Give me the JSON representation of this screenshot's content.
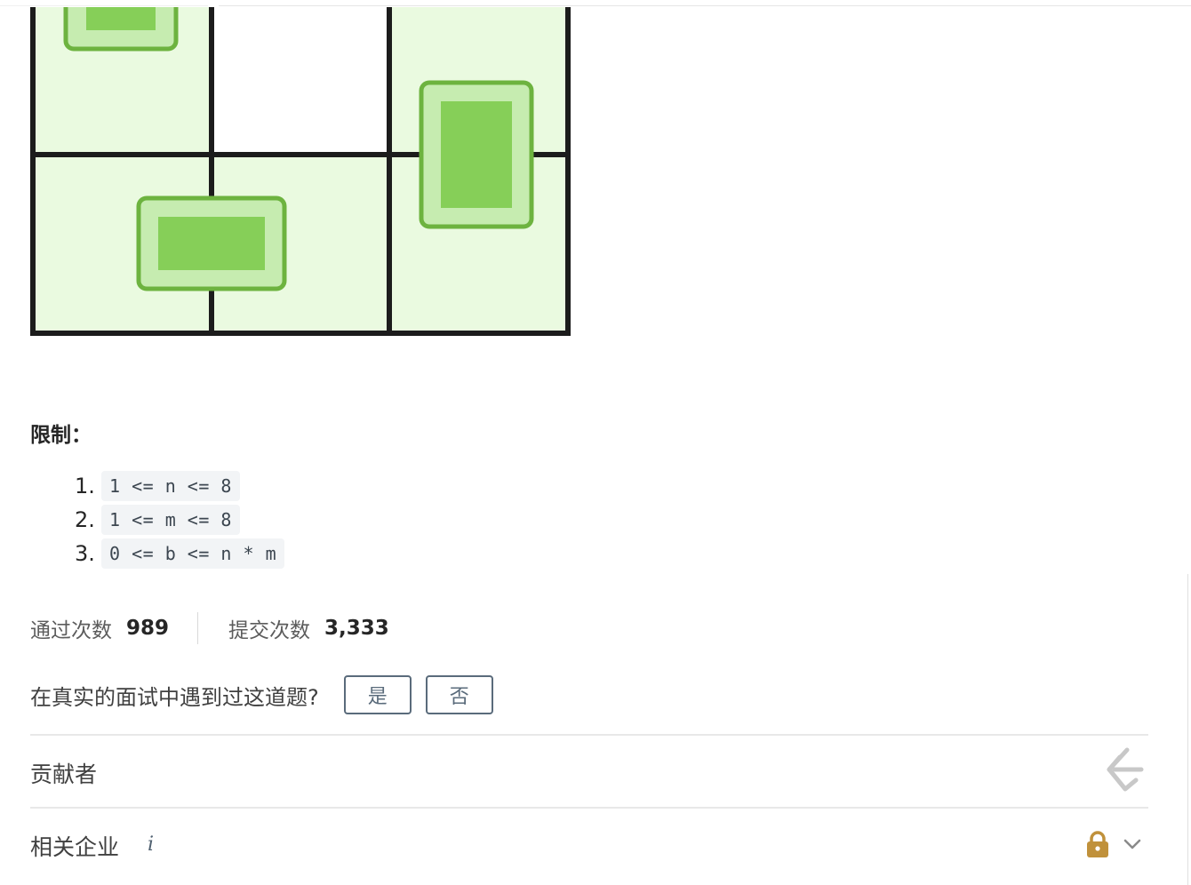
{
  "constraints": {
    "title": "限制：",
    "items": [
      {
        "num": "1.",
        "code": "1 <= n <= 8"
      },
      {
        "num": "2.",
        "code": "1 <= m <= 8"
      },
      {
        "num": "3.",
        "code": "0 <= b <= n * m"
      }
    ]
  },
  "stats": {
    "accepted_label": "通过次数",
    "accepted_value": "989",
    "submissions_label": "提交次数",
    "submissions_value": "3,333"
  },
  "interview": {
    "question": "在真实的面试中遇到过这道题?",
    "yes_label": "是",
    "no_label": "否"
  },
  "contributors": {
    "label": "贡献者",
    "icon": "leetcode-logo-icon"
  },
  "companies": {
    "label": "相关企业",
    "info_icon": "i",
    "lock_icon": "lock-icon",
    "expand_icon": "chevron-down-icon"
  },
  "colors": {
    "cell_fill": "#eafae0",
    "tile_border": "#6db33f",
    "tile_inner": "#c6ecb0",
    "tile_core": "#86cf58",
    "grid_line": "#1c1c1c",
    "lock": "#c0913b"
  }
}
